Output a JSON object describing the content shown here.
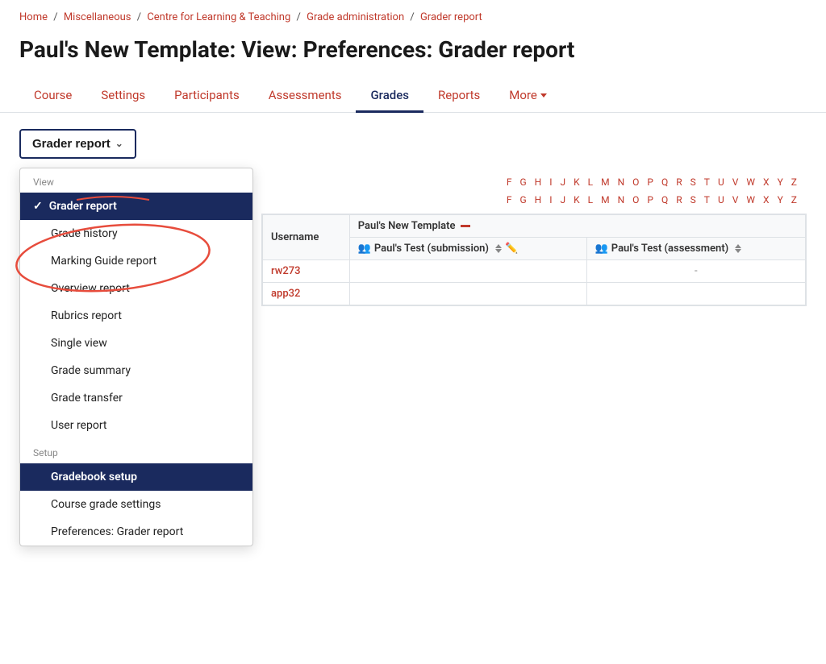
{
  "breadcrumb": {
    "items": [
      {
        "label": "Home",
        "href": "#"
      },
      {
        "label": "Miscellaneous",
        "href": "#"
      },
      {
        "label": "Centre for Learning & Teaching",
        "href": "#"
      },
      {
        "label": "Grade administration",
        "href": "#"
      },
      {
        "label": "Grader report",
        "href": "#"
      }
    ],
    "separator": "/"
  },
  "page_title": "Paul's New Template: View: Preferences: Grader report",
  "nav_tabs": [
    {
      "label": "Course",
      "active": false
    },
    {
      "label": "Settings",
      "active": false
    },
    {
      "label": "Participants",
      "active": false
    },
    {
      "label": "Assessments",
      "active": false
    },
    {
      "label": "Grades",
      "active": true
    },
    {
      "label": "Reports",
      "active": false
    },
    {
      "label": "More",
      "active": false,
      "has_arrow": true
    }
  ],
  "dropdown_button_label": "Grader report",
  "dropdown": {
    "sections": [
      {
        "label": "View",
        "items": [
          {
            "label": "Grader report",
            "active": true,
            "check": true
          },
          {
            "label": "Grade history",
            "active": false
          },
          {
            "label": "Marking Guide report",
            "active": false
          },
          {
            "label": "Overview report",
            "active": false
          },
          {
            "label": "Rubrics report",
            "active": false
          },
          {
            "label": "Single view",
            "active": false
          },
          {
            "label": "Grade summary",
            "active": false
          },
          {
            "label": "Grade transfer",
            "active": false
          },
          {
            "label": "User report",
            "active": false
          }
        ]
      },
      {
        "label": "Setup",
        "items": [
          {
            "label": "Gradebook setup",
            "active": true,
            "active_setup": true
          },
          {
            "label": "Course grade settings",
            "active": false
          },
          {
            "label": "Preferences: Grader report",
            "active": false
          }
        ]
      }
    ]
  },
  "alpha_rows": [
    [
      "F",
      "G",
      "H",
      "I",
      "J",
      "K",
      "L",
      "M",
      "N",
      "O",
      "P",
      "Q",
      "R",
      "S",
      "T",
      "U",
      "V",
      "W",
      "X",
      "Y",
      "Z"
    ],
    [
      "F",
      "G",
      "H",
      "I",
      "J",
      "K",
      "L",
      "M",
      "N",
      "O",
      "P",
      "Q",
      "R",
      "S",
      "T",
      "U",
      "V",
      "W",
      "X",
      "Y",
      "Z"
    ]
  ],
  "table": {
    "template_header": "Paul's New Template",
    "columns": [
      {
        "label": "Username"
      },
      {
        "label": "Paul's Test (submission)"
      },
      {
        "label": "Paul's Test (assessment)"
      }
    ],
    "rows": [
      {
        "username": "rw273",
        "submission": "",
        "assessment": "-"
      },
      {
        "username": "app32",
        "submission": "",
        "assessment": ""
      }
    ]
  }
}
